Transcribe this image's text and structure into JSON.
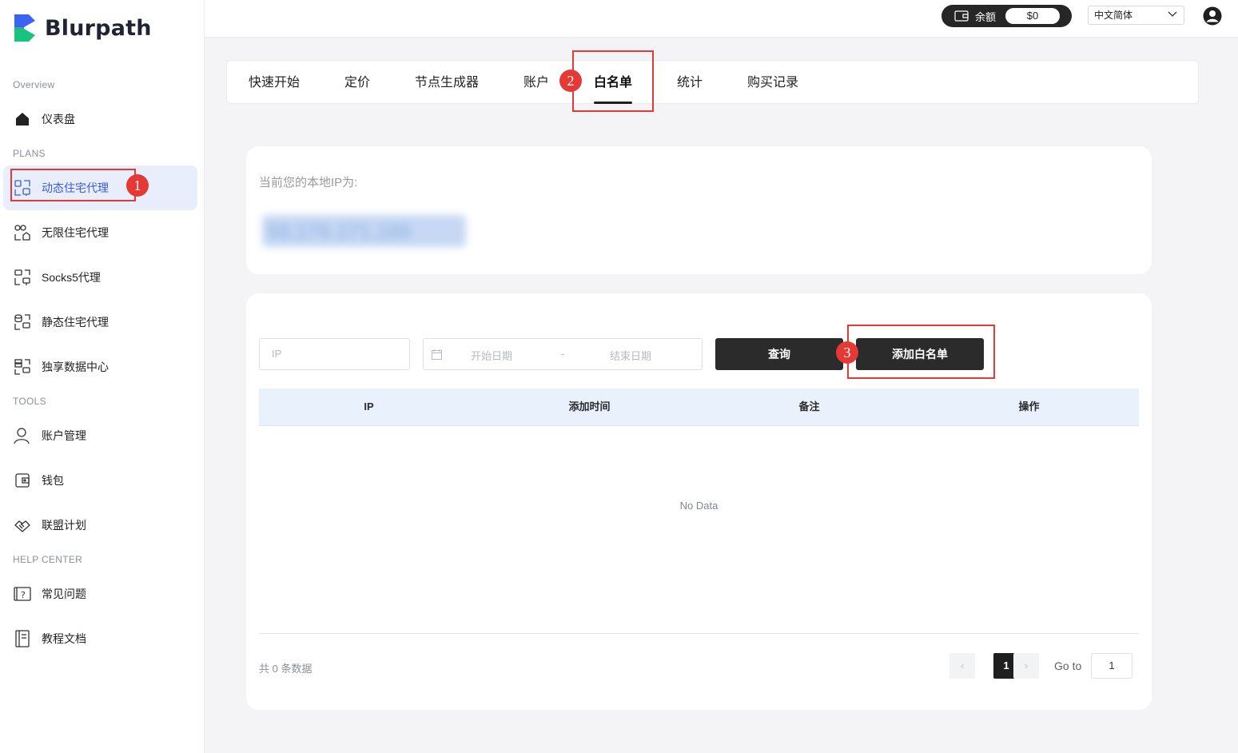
{
  "brand": {
    "name": "Blurpath"
  },
  "sidebar": {
    "sections": {
      "overview": "Overview",
      "plans": "PLANS",
      "tools": "TOOLS",
      "help": "HELP CENTER"
    },
    "items": [
      {
        "label": "仪表盘",
        "icon": "home-icon"
      },
      {
        "label": "动态住宅代理",
        "icon": "residential-proxy-icon",
        "active": true
      },
      {
        "label": "无限住宅代理",
        "icon": "unlimited-proxy-icon"
      },
      {
        "label": "Socks5代理",
        "icon": "socks5-icon"
      },
      {
        "label": "静态住宅代理",
        "icon": "static-proxy-icon"
      },
      {
        "label": "独享数据中心",
        "icon": "datacenter-icon"
      },
      {
        "label": "账户管理",
        "icon": "user-icon"
      },
      {
        "label": "钱包",
        "icon": "wallet-icon"
      },
      {
        "label": "联盟计划",
        "icon": "handshake-icon"
      },
      {
        "label": "常见问题",
        "icon": "faq-icon"
      },
      {
        "label": "教程文档",
        "icon": "docs-icon"
      }
    ]
  },
  "header": {
    "balance_label": "余额",
    "balance_value": "$0",
    "language": "中文简体"
  },
  "tabs": [
    {
      "label": "快速开始"
    },
    {
      "label": "定价"
    },
    {
      "label": "节点生成器"
    },
    {
      "label": "账户"
    },
    {
      "label": "白名单",
      "active": true
    },
    {
      "label": "统计"
    },
    {
      "label": "购买记录"
    }
  ],
  "ip_card": {
    "label": "当前您的本地IP为:",
    "ip_value": "58.176.171.186"
  },
  "filters": {
    "ip_placeholder": "IP",
    "start_date_placeholder": "开始日期",
    "separator": "-",
    "end_date_placeholder": "结束日期",
    "query_button": "查询",
    "add_button": "添加白名单"
  },
  "table": {
    "columns": [
      "IP",
      "添加时间",
      "备注",
      "操作"
    ],
    "empty_text": "No Data"
  },
  "pagination": {
    "total_text": "共 0 条数据",
    "current_page": "1",
    "goto_label": "Go to",
    "goto_value": "1",
    "prev": "‹",
    "next": "›"
  },
  "annotations": {
    "step1": "1",
    "step2": "2",
    "step3": "3",
    "color": "#e53935"
  }
}
